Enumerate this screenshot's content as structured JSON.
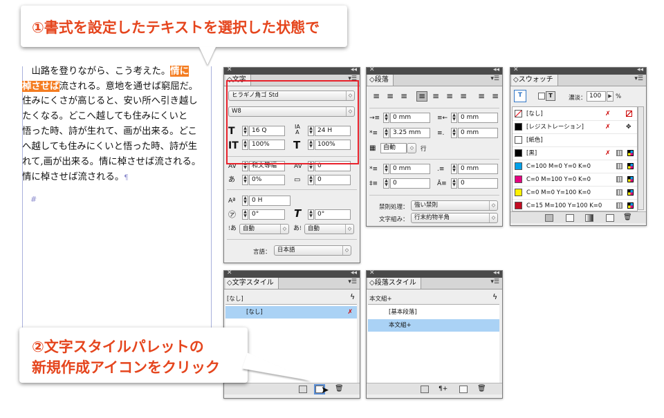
{
  "callouts": {
    "top": "①書式を設定したテキストを選択した状態で",
    "bottom_line1": "②文字スタイルパレットの",
    "bottom_line2": "新規作成アイコンをクリック"
  },
  "document": {
    "lines": [
      {
        "pre": "　山路を登りながら、こう考えた。",
        "hl": "情に",
        "post": ""
      },
      {
        "pre": "",
        "hl": "棹させば",
        "post": "流される。意地を通せば窮屈だ。"
      },
      {
        "pre": "住みにくさが高じると、安い所へ引き越し",
        "hl": "",
        "post": ""
      },
      {
        "pre": "たくなる。どこへ越しても住みにくいと",
        "hl": "",
        "post": ""
      },
      {
        "pre": "悟った時、詩が生れて、画が出来る。どこ",
        "hl": "",
        "post": ""
      },
      {
        "pre": "へ越しても住みにくいと悟った時、詩が生",
        "hl": "",
        "post": ""
      },
      {
        "pre": "れて,画が出来る。情に棹させば流される。",
        "hl": "",
        "post": ""
      },
      {
        "pre": "情に棹させば流される。",
        "hl": "",
        "post": "¶"
      }
    ],
    "end_mark": "#"
  },
  "char_panel": {
    "tab": "◇文字",
    "font_family": "ヒラギノ角ゴ Std",
    "font_style": "W8",
    "size": "16 Q",
    "leading": "24 H",
    "vscale": "100%",
    "hscale": "100%",
    "kerning": "和文等幅",
    "tracking": "0",
    "tsume": "0%",
    "aki": "0",
    "baseline": "0 H",
    "rotation": "0°",
    "skew": "0°",
    "aki_before": "自動",
    "aki_after": "自動",
    "lang_label": "言語：",
    "lang": "日本語"
  },
  "para_panel": {
    "tab": "◇段落",
    "left_indent": "0 mm",
    "right_indent": "0 mm",
    "first_indent": "3.25 mm",
    "last_indent": "0 mm",
    "dropcap_lines": "自動",
    "dropcap_unit": "行",
    "space_before": "0 mm",
    "space_after": "0 mm",
    "dropcap_chars": "0",
    "dropcap_n": "0",
    "kinsoku_label": "禁則処理：",
    "kinsoku": "強い禁則",
    "mojikumi_label": "文字組み：",
    "mojikumi": "行末約物半角"
  },
  "swatch_panel": {
    "tab": "◇スウォッチ",
    "tint_label": "濃淡：",
    "tint": "100",
    "tint_unit": "%",
    "rows": [
      {
        "name": "[なし]",
        "color": "#ffffff",
        "special": "none"
      },
      {
        "name": "[レジストレーション]",
        "color": "#000000",
        "special": "reg"
      },
      {
        "name": "[紙色]",
        "color": "#ffffff",
        "special": "paper"
      },
      {
        "name": "[黒]",
        "color": "#000000",
        "special": "black"
      },
      {
        "name": "C=100 M=0 Y=0 K=0",
        "color": "#00a0e9",
        "special": "cmyk"
      },
      {
        "name": "C=0 M=100 Y=0 K=0",
        "color": "#e4007f",
        "special": "cmyk"
      },
      {
        "name": "C=0 M=0 Y=100 K=0",
        "color": "#fff100",
        "special": "cmyk"
      },
      {
        "name": "C=15 M=100 Y=100 K=0",
        "color": "#c30d23",
        "special": "cmyk"
      }
    ]
  },
  "charstyle_panel": {
    "tab": "◇文字スタイル",
    "current": "[なし]",
    "items": [
      "[なし]"
    ]
  },
  "parastyle_panel": {
    "tab": "◇段落スタイル",
    "current": "本文組+",
    "items": [
      "[基本段落]",
      "本文組+"
    ]
  },
  "colors": {
    "highlight": "#f47c20",
    "callout_text": "#e5451d",
    "selection": "#aad2f5",
    "red_box": "#e8202a"
  }
}
